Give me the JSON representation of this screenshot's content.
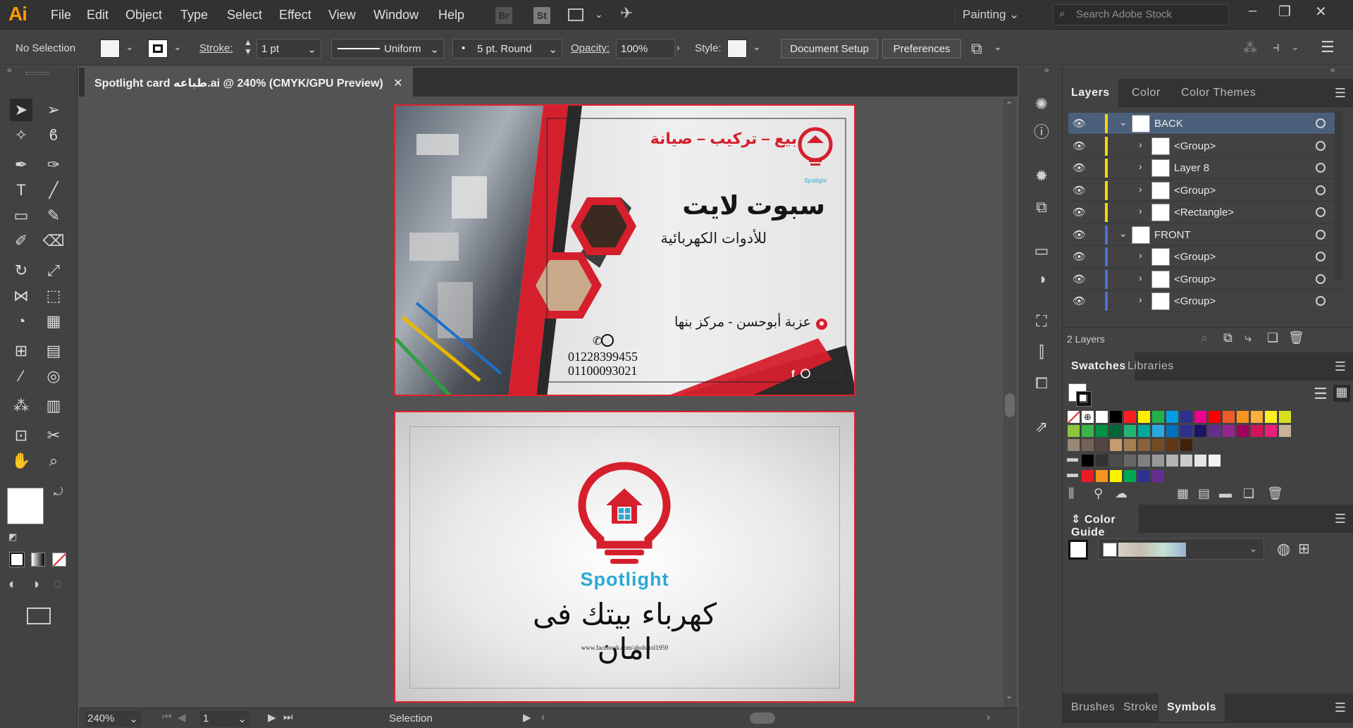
{
  "app": {
    "logo": "Ai",
    "workspace": "Painting",
    "search_placeholder": "Search Adobe Stock"
  },
  "menu": [
    "File",
    "Edit",
    "Object",
    "Type",
    "Select",
    "Effect",
    "View",
    "Window",
    "Help"
  ],
  "bridge": {
    "br": "Br",
    "st": "St"
  },
  "control": {
    "selection": "No Selection",
    "stroke_label": "Stroke:",
    "stroke_weight": "1 pt",
    "profile": "Uniform",
    "brush": "5 pt. Round",
    "opacity_label": "Opacity:",
    "opacity": "100%",
    "style_label": "Style:",
    "document_setup": "Document Setup",
    "preferences": "Preferences"
  },
  "document": {
    "tab_title": "Spotlight card طباعه.ai @ 240% (CMYK/GPU Preview)"
  },
  "status": {
    "zoom": "240%",
    "page": "1",
    "tool": "Selection"
  },
  "card_front": {
    "services": "بيع – تركيب – صيانة",
    "name": "سبوت لايت",
    "subtitle": "للأدوات الكهربائية",
    "brand_small": "Spotlight",
    "address": "عزبة أبوحسن - مركز بنها",
    "phone1": "01228399455",
    "phone2": "01100093021"
  },
  "card_back": {
    "brand": "Spotlight",
    "slogan": "كهرباء بيتك فى امان",
    "url": "www.facebook.com/abobatol1959"
  },
  "panels": {
    "layers_tabs": [
      "Layers",
      "Color",
      "Color Themes"
    ],
    "layers": [
      {
        "name": "BACK",
        "level": 0,
        "expanded": true,
        "color": "#f5d800"
      },
      {
        "name": "<Group>",
        "level": 1,
        "color": "#f5d800"
      },
      {
        "name": "Layer 8",
        "level": 1,
        "color": "#f5d800"
      },
      {
        "name": "<Group>",
        "level": 1,
        "color": "#f5d800"
      },
      {
        "name": "<Rectangle>",
        "level": 1,
        "color": "#f5d800"
      },
      {
        "name": "FRONT",
        "level": 0,
        "expanded": true,
        "color": "#4a6fd8"
      },
      {
        "name": "<Group>",
        "level": 1,
        "color": "#4a6fd8"
      },
      {
        "name": "<Group>",
        "level": 1,
        "color": "#4a6fd8"
      },
      {
        "name": "<Group>",
        "level": 1,
        "color": "#4a6fd8"
      }
    ],
    "layer_count": "2 Layers",
    "swatch_tabs": [
      "Swatches",
      "Libraries"
    ],
    "colorguide": "Color Guide",
    "bottom_tabs": [
      "Brushes",
      "Stroke",
      "Symbols"
    ]
  },
  "swatch_colors": {
    "row1": [
      "#000000",
      "#ff1d25",
      "#ffed00",
      "#22b24c",
      "#009fe3",
      "#2e3192",
      "#ec008c",
      "#ff0000",
      "#f15a24",
      "#f7931e",
      "#fbb03b",
      "#fcee21",
      "#d9e021"
    ],
    "row2": [
      "#8cc63f",
      "#39b54a",
      "#009245",
      "#006837",
      "#22b573",
      "#00a99d",
      "#29abe2",
      "#0071bc",
      "#2e3192",
      "#1b1464",
      "#662d91",
      "#93278f",
      "#9e005d",
      "#d4145a",
      "#ed1e79",
      "#c7b299"
    ],
    "row3": [
      "#998675",
      "#736357",
      "#534741",
      "#c69c6d",
      "#a67c52",
      "#8c6239",
      "#754c24",
      "#603813",
      "#42210b"
    ],
    "row4": [
      "#000000",
      "#333333",
      "#4d4d4d",
      "#666666",
      "#808080",
      "#999999",
      "#b3b3b3",
      "#cccccc",
      "#e6e6e6",
      "#f2f2f2"
    ],
    "row5": [
      "#ed1c24",
      "#f7941d",
      "#fff200",
      "#00a651",
      "#2e3192",
      "#662d91"
    ]
  },
  "colors": {
    "accent_red": "#e02030",
    "spotlight_teal": "#29a9d6",
    "selected_layer": "#4c5f7a"
  }
}
